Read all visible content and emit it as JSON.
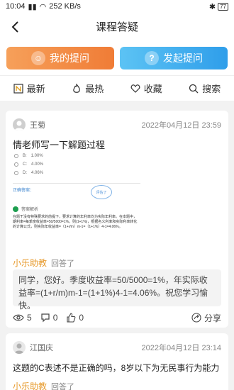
{
  "status_bar": {
    "time": "10:04",
    "speed": "252 KB/s",
    "battery": "77"
  },
  "nav": {
    "title": "课程答疑"
  },
  "actions": {
    "my_questions": "我的提问",
    "ask_question": "发起提问",
    "my_icon": "person-icon",
    "ask_icon": "question-mark-icon"
  },
  "tabs": [
    {
      "label": "最新",
      "icon": "new-badge-icon"
    },
    {
      "label": "最热",
      "icon": "flame-icon"
    },
    {
      "label": "收藏",
      "icon": "heart-icon"
    },
    {
      "label": "搜索",
      "icon": "search-icon"
    }
  ],
  "posts": [
    {
      "author": "王菊",
      "time": "2022年04月12日 23:59",
      "question": "情老师写一下解题过程",
      "image": {
        "options": [
          {
            "key": "B:",
            "value": "1.00%"
          },
          {
            "key": "C:",
            "value": "4.00%"
          },
          {
            "key": "D:",
            "value": "4.06%"
          }
        ],
        "answer_label": "正确答案：",
        "stamp": "评估了",
        "analysis_label": "答案解析",
        "analysis": "在题干没有特殊要求的前提下，要求计算的年利率均为实际年利率。在本题中，期利率=每季度收益率=50/5000=1%，则(1+1%)，根据名义利率和实际利率转化的计算公式，则实际年收益率=（1+r/m）m-1=（1+1%）4-1=4.06%。"
      },
      "answerer": "小乐助教",
      "answered": "回答了",
      "reply": "同学，您好。季度收益率=50/5000=1%，年实际收益率=(1+r/m)m-1=(1+1%)4-1=4.06%。祝您学习愉快。",
      "views": "5",
      "comments": "0",
      "likes": "0",
      "share": "分享"
    },
    {
      "author": "江国庆",
      "time": "2022年04月12日 23:14",
      "question": "这题的C表述不是正确的吗，8岁以下为无民事行为能力",
      "answerer": "小乐助教",
      "answered": "回答了"
    }
  ],
  "colors": {
    "orange": "#f07c36",
    "blue": "#2f9eea",
    "answerer": "#e79a2c"
  }
}
